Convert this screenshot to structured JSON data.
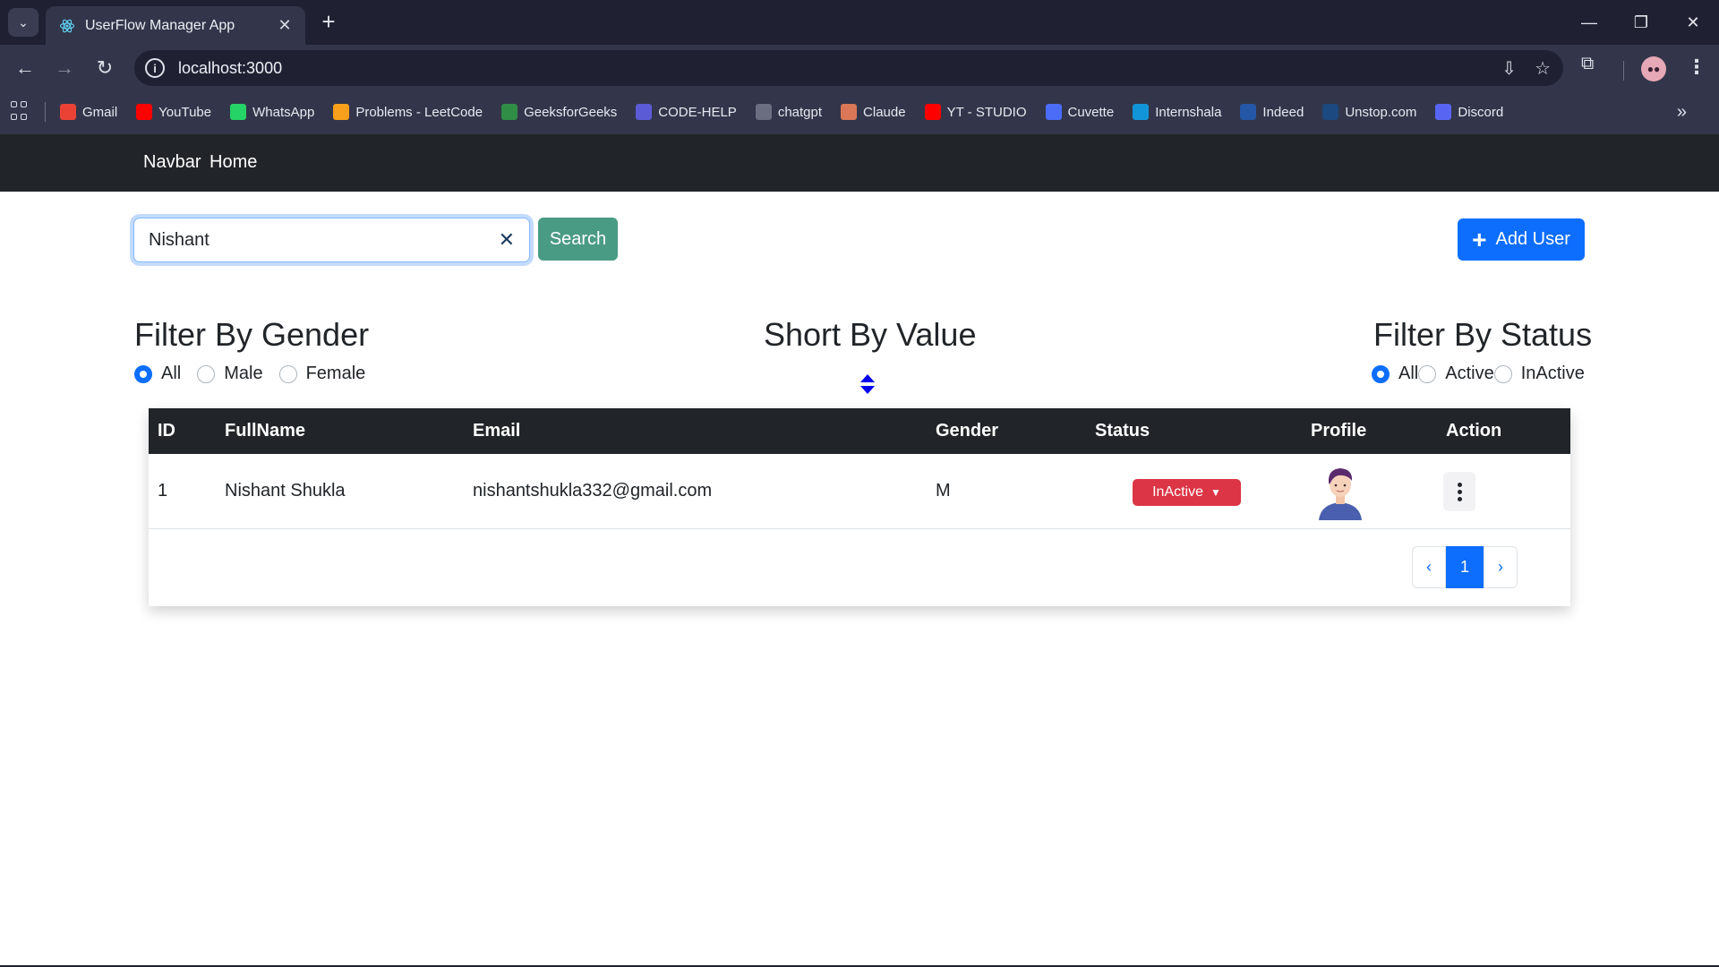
{
  "browser": {
    "tab_title": "UserFlow Manager App",
    "url": "localhost:3000",
    "bookmarks": [
      {
        "label": "Gmail",
        "icon": "gmail-icon",
        "color": "#ea4335"
      },
      {
        "label": "YouTube",
        "icon": "youtube-icon",
        "color": "#ff0000"
      },
      {
        "label": "WhatsApp",
        "icon": "whatsapp-icon",
        "color": "#25d366"
      },
      {
        "label": "Problems - LeetCode",
        "icon": "leetcode-icon",
        "color": "#f89f1b"
      },
      {
        "label": "GeeksforGeeks",
        "icon": "geeksforgeeks-icon",
        "color": "#2f8d46"
      },
      {
        "label": "CODE-HELP",
        "icon": "codehelp-icon",
        "color": "#5b5bd6"
      },
      {
        "label": "chatgpt",
        "icon": "chatgpt-icon",
        "color": "#6b6e80"
      },
      {
        "label": "Claude",
        "icon": "claude-icon",
        "color": "#d97757"
      },
      {
        "label": "YT - STUDIO",
        "icon": "yt-studio-icon",
        "color": "#ff0000"
      },
      {
        "label": "Cuvette",
        "icon": "cuvette-icon",
        "color": "#4a6cf7"
      },
      {
        "label": "Internshala",
        "icon": "internshala-icon",
        "color": "#1295d8"
      },
      {
        "label": "Indeed",
        "icon": "indeed-icon",
        "color": "#2557a7"
      },
      {
        "label": "Unstop.com",
        "icon": "unstop-icon",
        "color": "#1c4980"
      },
      {
        "label": "Discord",
        "icon": "discord-icon",
        "color": "#5865f2"
      }
    ]
  },
  "navbar": {
    "brand": "Navbar",
    "home": "Home"
  },
  "search": {
    "value": "Nishant",
    "placeholder": "",
    "button_label": "Search"
  },
  "add_user": {
    "label": "Add User"
  },
  "filters": {
    "gender": {
      "title": "Filter By Gender",
      "options": [
        "All",
        "Male",
        "Female"
      ],
      "selected": "All"
    },
    "sort": {
      "title": "Short By Value"
    },
    "status": {
      "title": "Filter By Status",
      "options": [
        "All",
        "Active",
        "InActive"
      ],
      "selected": "All"
    }
  },
  "table": {
    "columns": [
      "ID",
      "FullName",
      "Email",
      "Gender",
      "Status",
      "Profile",
      "Action"
    ],
    "rows": [
      {
        "id": "1",
        "full_name": "Nishant Shukla",
        "email": "nishantshukla332@gmail.com",
        "gender": "M",
        "status": "InActive"
      }
    ]
  },
  "pagination": {
    "prev": "‹",
    "current": "1",
    "next": "›"
  },
  "colors": {
    "navbar_bg": "#212529",
    "primary": "#0d6efd",
    "search_button": "#4a9b84",
    "status_inactive": "#dc3545"
  }
}
